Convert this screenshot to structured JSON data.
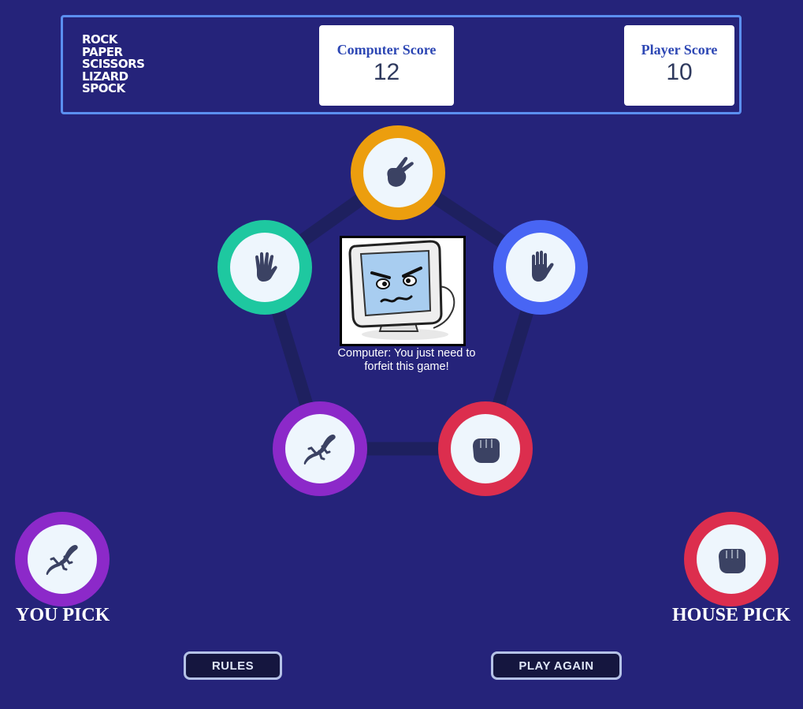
{
  "header": {
    "logo_lines": [
      "ROCK",
      "PAPER",
      "SCISSORS",
      "LIZARD",
      "SPOCK"
    ],
    "computer_score": {
      "label": "Computer Score",
      "value": "12"
    },
    "player_score": {
      "label": "Player Score",
      "value": "10"
    }
  },
  "board": {
    "tokens": [
      {
        "name": "scissors",
        "icon": "scissors-icon",
        "color": "#ec9e0e"
      },
      {
        "name": "paper",
        "icon": "paper-icon",
        "color": "#4865f4"
      },
      {
        "name": "rock",
        "icon": "rock-icon",
        "color": "#dc2e4e"
      },
      {
        "name": "lizard",
        "icon": "lizard-icon",
        "color": "#8c29c9"
      },
      {
        "name": "spock",
        "icon": "spock-icon",
        "color": "#1ec8a0"
      }
    ],
    "computer_message": "Computer: You just need to forfeit this game!"
  },
  "you_pick": {
    "label": "YOU PICK",
    "choice": "lizard",
    "color": "#8c29c9"
  },
  "house_pick": {
    "label": "HOUSE PICK",
    "choice": "rock",
    "color": "#dc2e4e"
  },
  "buttons": {
    "rules": "RULES",
    "play_again": "PLAY AGAIN"
  },
  "colors": {
    "background": "#25237a",
    "header_border": "#5b8ff0",
    "icon": "#3b4263"
  }
}
